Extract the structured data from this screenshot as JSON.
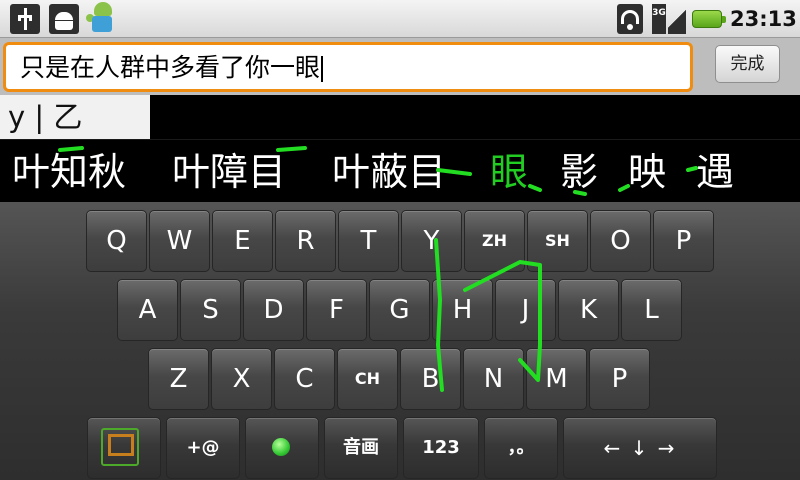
{
  "status_bar": {
    "icons": [
      "usb-icon",
      "android-debug-icon",
      "android-app-icon",
      "wifi-icon",
      "signal-3g-icon",
      "battery-icon"
    ],
    "signal_label": "3G",
    "time": "23:13"
  },
  "editor": {
    "text": "只是在人群中多看了你一眼",
    "done_label": "完成"
  },
  "ime": {
    "composing": "y | 乙",
    "candidates": [
      "叶知秋",
      "叶障目",
      "叶蔽目",
      "眼",
      "影",
      "映",
      "遇"
    ],
    "selected_candidate": "眼",
    "handwriting_color": "#22dd22"
  },
  "keyboard": {
    "row1": [
      "Q",
      "W",
      "E",
      "R",
      "T",
      "Y",
      "ZH",
      "SH",
      "O",
      "P"
    ],
    "row2": [
      "A",
      "S",
      "D",
      "F",
      "G",
      "H",
      "J",
      "K",
      "L"
    ],
    "row3": [
      "Z",
      "X",
      "C",
      "CH",
      "B",
      "N",
      "M",
      "P"
    ],
    "bottom": {
      "symbols_label": "+@",
      "handwriting_label": "音画",
      "numbers_label": "123",
      "punct_label": "，。",
      "arrows_label": "← ↓ →"
    }
  }
}
